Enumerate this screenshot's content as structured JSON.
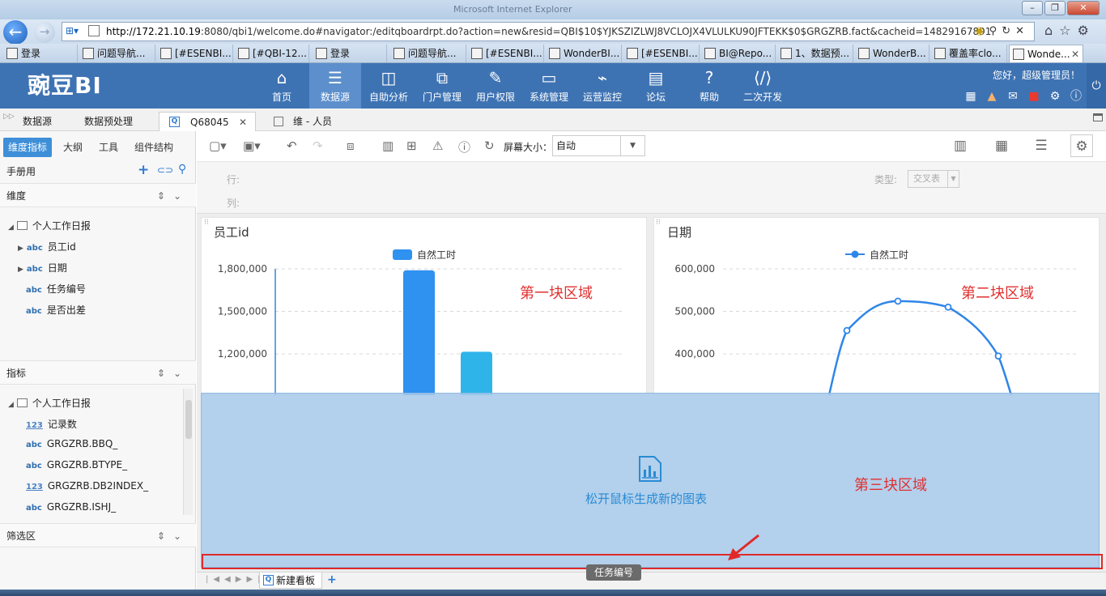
{
  "browser": {
    "window_title": "Microsoft Internet Explorer",
    "url_host": "http://172.21.10.19",
    "url_rest": ":8080/qbi1/welcome.do#navigator:/editqboardrpt.do?action=new&resid=QBI$10$YJKSZIZLWJ8VCLOJX4VLULKU90JFTEKK$0$GRGZRB.fact&cacheid=14829167891",
    "tabs": [
      {
        "label": "登录"
      },
      {
        "label": "问题导航..."
      },
      {
        "label": "[#ESENBI..."
      },
      {
        "label": "[#QBI-12..."
      },
      {
        "label": "登录"
      },
      {
        "label": "问题导航..."
      },
      {
        "label": "[#ESENBI..."
      },
      {
        "label": "WonderBI..."
      },
      {
        "label": "[#ESENBI..."
      },
      {
        "label": "BI@Repo..."
      },
      {
        "label": "1、数据预..."
      },
      {
        "label": "WonderB..."
      },
      {
        "label": "覆盖率clo..."
      },
      {
        "label": "Wonde..."
      }
    ]
  },
  "app": {
    "logo": "豌豆BI",
    "nav": [
      {
        "label": "首页",
        "icon": "home-icon"
      },
      {
        "label": "数据源",
        "icon": "database-icon"
      },
      {
        "label": "自助分析",
        "icon": "analysis-icon"
      },
      {
        "label": "门户管理",
        "icon": "portal-icon"
      },
      {
        "label": "用户权限",
        "icon": "tools-icon"
      },
      {
        "label": "系统管理",
        "icon": "monitor-icon"
      },
      {
        "label": "运营监控",
        "icon": "pulse-icon"
      },
      {
        "label": "论坛",
        "icon": "chat-icon"
      },
      {
        "label": "帮助",
        "icon": "help-icon"
      },
      {
        "label": "二次开发",
        "icon": "code-icon"
      }
    ],
    "greeting": "您好，超级管理员！",
    "colors": {
      "header": "#3e73b3",
      "active_nav": "#5c8fcc",
      "accent": "#3e8fd8",
      "annotation": "#e03030"
    }
  },
  "app_tabs": [
    {
      "label": "数据源"
    },
    {
      "label": "数据预处理"
    },
    {
      "label": "Q68045"
    },
    {
      "label": "维 - 人员"
    }
  ],
  "left": {
    "tabs": [
      "维度指标",
      "大纲",
      "工具",
      "组件结构"
    ],
    "manual_label": "手册用",
    "dimension_title": "维度",
    "dimension_root": "个人工作日报",
    "dimensions": [
      {
        "type": "abc",
        "label": "员工id",
        "expandable": true
      },
      {
        "type": "abc",
        "label": "日期",
        "expandable": true
      },
      {
        "type": "abc",
        "label": "任务编号",
        "expandable": false
      },
      {
        "type": "abc",
        "label": "是否出差",
        "expandable": false
      }
    ],
    "measure_title": "指标",
    "measure_root": "个人工作日报",
    "measures": [
      {
        "type": "123",
        "label": "记录数"
      },
      {
        "type": "abc",
        "label": "GRGZRB.BBQ_"
      },
      {
        "type": "abc",
        "label": "GRGZRB.BTYPE_"
      },
      {
        "type": "123",
        "label": "GRGZRB.DB2INDEX_"
      },
      {
        "type": "abc",
        "label": "GRGZRB.ISHJ_"
      }
    ],
    "filter_title": "筛选区"
  },
  "toolbar": {
    "screen_size_label": "屏幕大小：",
    "screen_size_value": "自动"
  },
  "rowcol": {
    "row_label": "行:",
    "col_label": "列:",
    "type_label": "类型:",
    "type_value": "交叉表"
  },
  "chart_data": [
    {
      "type": "bar",
      "title": "员工id",
      "series": [
        {
          "name": "自然工时",
          "values": [
            1790000,
            1215000
          ]
        }
      ],
      "y_ticks": [
        "1,800,000",
        "1,500,000",
        "1,200,000"
      ],
      "ylim": [
        1200000,
        1800000
      ],
      "grid": true,
      "legend": "top-center"
    },
    {
      "type": "line",
      "title": "日期",
      "series": [
        {
          "name": "自然工时",
          "values": [
            455000,
            524000,
            510000,
            395000
          ]
        }
      ],
      "y_ticks": [
        "600,000",
        "500,000",
        "400,000"
      ],
      "ylim": [
        400000,
        600000
      ],
      "grid": true,
      "legend": "top-center"
    }
  ],
  "annotations": {
    "area1": "第一块区域",
    "area2": "第二块区域",
    "area3": "第三块区域"
  },
  "drop": {
    "hint": "松开鼠标生成新的图表",
    "drag_tip": "任务编号"
  },
  "sheets": {
    "tab": "新建看板",
    "add": "+"
  }
}
